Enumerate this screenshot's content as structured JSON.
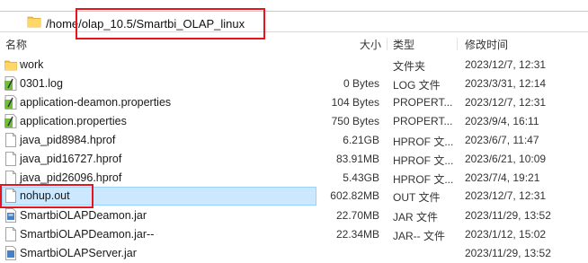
{
  "path": {
    "text": "/home/olap_10.5/Smartbi_OLAP_linux",
    "icon": "folder-icon"
  },
  "columns": {
    "name": "名称",
    "size": "大小",
    "type": "类型",
    "modified": "修改时间"
  },
  "files": [
    {
      "name": "work",
      "size": "",
      "type": "文件夹",
      "modified": "2023/12/7, 12:31",
      "icon": "folder-icon"
    },
    {
      "name": "0301.log",
      "size": "0 Bytes",
      "type": "LOG 文件",
      "modified": "2023/3/31, 12:14",
      "icon": "text-file-icon"
    },
    {
      "name": "application-deamon.properties",
      "size": "104 Bytes",
      "type": "PROPERT...",
      "modified": "2023/12/7, 12:31",
      "icon": "text-file-icon"
    },
    {
      "name": "application.properties",
      "size": "750 Bytes",
      "type": "PROPERT...",
      "modified": "2023/9/4, 16:11",
      "icon": "text-file-icon"
    },
    {
      "name": "java_pid8984.hprof",
      "size": "6.21GB",
      "type": "HPROF 文...",
      "modified": "2023/6/7, 11:47",
      "icon": "file-icon"
    },
    {
      "name": "java_pid16727.hprof",
      "size": "83.91MB",
      "type": "HPROF 文...",
      "modified": "2023/6/21, 10:09",
      "icon": "file-icon"
    },
    {
      "name": "java_pid26096.hprof",
      "size": "5.43GB",
      "type": "HPROF 文...",
      "modified": "2023/7/4, 19:21",
      "icon": "file-icon"
    },
    {
      "name": "nohup.out",
      "size": "602.82MB",
      "type": "OUT 文件",
      "modified": "2023/12/7, 12:31",
      "icon": "file-icon",
      "selected": true
    },
    {
      "name": "SmartbiOLAPDeamon.jar",
      "size": "22.70MB",
      "type": "JAR 文件",
      "modified": "2023/11/29, 13:52",
      "icon": "jar-icon"
    },
    {
      "name": "SmartbiOLAPDeamon.jar--",
      "size": "22.34MB",
      "type": "JAR-- 文件",
      "modified": "2023/1/12, 15:02",
      "icon": "file-icon"
    },
    {
      "name": "SmartbiOLAPServer.jar",
      "size": "",
      "type": "",
      "modified": "2023/11/29, 13:52",
      "icon": "jar-icon"
    }
  ],
  "colors": {
    "selection": "#cce8ff",
    "highlight_box": "#e8141b",
    "folder": "#f5c542"
  }
}
